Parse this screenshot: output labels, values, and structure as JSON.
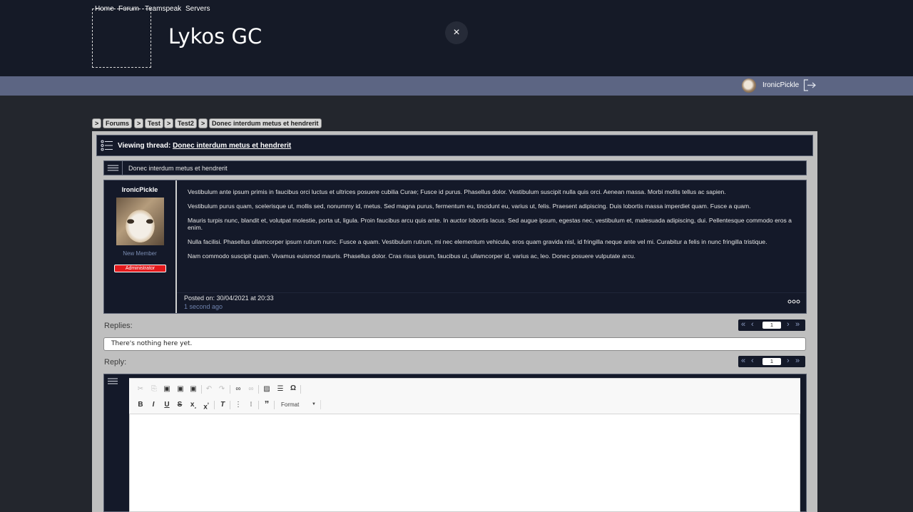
{
  "site": {
    "title": "Lykos GC",
    "close_icon": "×"
  },
  "nav": {
    "items": [
      "Home",
      "Forum",
      "Teamspeak",
      "Servers"
    ],
    "username": "IronicPickle"
  },
  "breadcrumb": {
    "separator": ">",
    "items": [
      "Forums",
      "Test",
      "Test2",
      "Donec interdum metus et hendrerit"
    ]
  },
  "thread": {
    "viewing_label": "Viewing thread:",
    "title": "Donec interdum metus et hendrerit"
  },
  "post": {
    "title": "Donec interdum metus et hendrerit",
    "author": {
      "name": "IronicPickle",
      "rank": "New Member",
      "badge": "Administrator",
      "badge_color": "#e3191c"
    },
    "paragraphs": [
      "Vestibulum ante ipsum primis in faucibus orci luctus et ultrices posuere cubilia Curae; Fusce id purus. Phasellus dolor. Vestibulum suscipit nulla quis orci. Aenean massa. Morbi mollis tellus ac sapien.",
      "Vestibulum purus quam, scelerisque ut, mollis sed, nonummy id, metus. Sed magna purus, fermentum eu, tincidunt eu, varius ut, felis. Praesent adipiscing. Duis lobortis massa imperdiet quam. Fusce a quam.",
      "Mauris turpis nunc, blandit et, volutpat molestie, porta ut, ligula. Proin faucibus arcu quis ante. In auctor lobortis lacus. Sed augue ipsum, egestas nec, vestibulum et, malesuada adipiscing, dui. Pellentesque commodo eros a enim.",
      "Nulla facilisi. Phasellus ullamcorper ipsum rutrum nunc. Fusce a quam. Vestibulum rutrum, mi nec elementum vehicula, eros quam gravida nisl, id fringilla neque ante vel mi. Curabitur a felis in nunc fringilla tristique.",
      "Nam commodo suscipit quam. Vivamus euismod mauris. Phasellus dolor. Cras risus ipsum, faucibus ut, ullamcorper id, varius ac, leo. Donec posuere vulputate arcu."
    ],
    "posted_on": "Posted on: 30/04/2021 at 20:33",
    "posted_ago": "1 second ago"
  },
  "replies": {
    "label": "Replies:",
    "empty_text": "There's nothing here yet.",
    "page": "1"
  },
  "reply": {
    "label": "Reply:",
    "page": "1",
    "format_label": "Format"
  },
  "colors": {
    "header_bg": "#151a27",
    "nav_bg": "#5c6583",
    "panel_bg": "#bfbfbf",
    "card_bg": "#141929"
  }
}
